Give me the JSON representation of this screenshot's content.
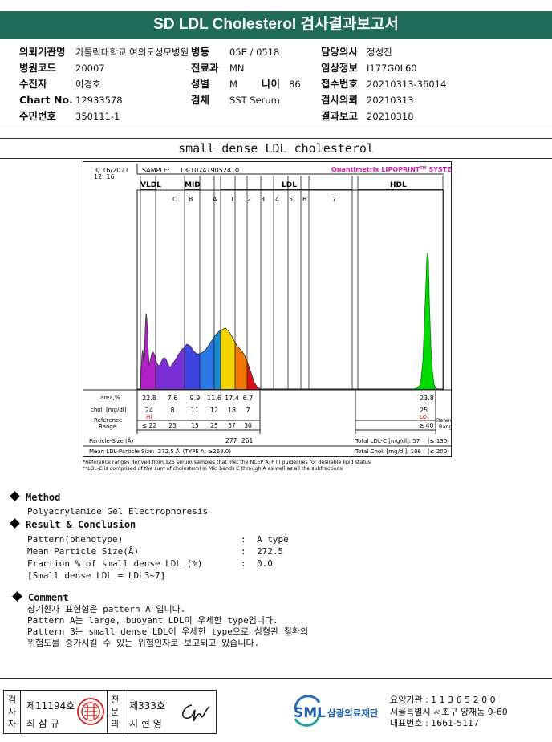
{
  "title": "SD LDL Cholesterol 검사결과보고서",
  "header": {
    "left": [
      {
        "label": "의뢰기관명",
        "value": "가톨릭대학교 여의도성모병원"
      },
      {
        "label": "병원코드",
        "value": "20007"
      },
      {
        "label": "수진자",
        "value": "이경호"
      },
      {
        "label": "Chart No.",
        "value": "12933578"
      },
      {
        "label": "주민번호",
        "value": "350111-1"
      }
    ],
    "mid": [
      {
        "label": "병동",
        "value": "05E / 0518"
      },
      {
        "label": "진료과",
        "value": "MN"
      },
      {
        "label": "성별",
        "value": "M"
      },
      {
        "label": "검체",
        "value": "SST Serum"
      }
    ],
    "age_label": "나이",
    "age_value": "86",
    "right": [
      {
        "label": "담당의사",
        "value": "정성진"
      },
      {
        "label": "임상정보",
        "value": "I177G0L60"
      },
      {
        "label": "접수번호",
        "value": "20210313-36014"
      },
      {
        "label": "검사의뢰",
        "value": "20210313"
      },
      {
        "label": "결과보고",
        "value": "20210318"
      }
    ]
  },
  "section_title": "small dense LDL cholesterol",
  "chart_data": {
    "type": "area",
    "date": "3/ 16/2021",
    "time": "12: 16",
    "sample_label": "SAMPLE:",
    "sample_id": "13-107419052410",
    "system": "Quantimetrix LIPOPRINT",
    "system_sup": "TM",
    "system_tail": " SYSTEM",
    "regions": [
      "VLDL",
      "MID",
      "LDL",
      "HDL"
    ],
    "bands": [
      "C",
      "B",
      "A",
      "1",
      "2",
      "3",
      "4",
      "5",
      "6",
      "7"
    ],
    "row_labels": {
      "area": "area,%",
      "chol": "chol. [mg/dl]",
      "ref1": "Reference",
      "ref2": "Range",
      "particle": "Particle-Size (Å)",
      "mean": "Mean LDL-Particle Size:",
      "mean_value": "272.5 Å",
      "mean_type": "(TYPE A; ≥268.0)"
    },
    "area_values": [
      "22.8",
      "7.6",
      "9.9",
      "11.6",
      "17.4",
      "6.7"
    ],
    "hdl_area": "23.8",
    "chol_values": [
      "24",
      "8",
      "11",
      "12",
      "18",
      "7"
    ],
    "vldl_flag": "HI",
    "hdl_chol": "25",
    "hdl_flag": "LO",
    "ref_values": [
      "≤ 22",
      "23",
      "15",
      "25",
      "57",
      "30"
    ],
    "hdl_ref": "≥ 40",
    "ref_side1": "Reference",
    "ref_side2": "Range",
    "particle_sizes": [
      "277",
      "261"
    ],
    "total_ldl_label": "Total LDL-C [mg/dl]: 57",
    "total_ldl_range": "(≤ 130)",
    "total_chol_label": "Total Chol. [mg/dl]: 106",
    "total_chol_range": "(≤ 200)",
    "footnote1": "*Reference ranges derived from 125 serum samples that met the NCEP ATP III guidelines for desirable lipid status",
    "footnote2": "**LDL-C is comprised of the sum of cholesterol in Mid bands C through A as well as all the subfractions",
    "colors": {
      "vldl": "#b21fc9",
      "mid": "#3357e0",
      "ldl1": "#f1d400",
      "ldl2": "#f07800",
      "ldl3": "#e01010",
      "hdl": "#00dc00"
    }
  },
  "method": {
    "heading": "Method",
    "text": "Polyacrylamide Gel Electrophoresis"
  },
  "result": {
    "heading": "Result & Conclusion",
    "rows": [
      {
        "label": "Pattern(phenotype)",
        "value": "A type"
      },
      {
        "label": "Mean Particle Size(Å)",
        "value": "272.5"
      },
      {
        "label": "Fraction % of small dense LDL (%)",
        "value": "0.0"
      }
    ],
    "note": "[Small dense LDL = LDL3~7]"
  },
  "comment": {
    "heading": "Comment",
    "lines": [
      "상기환자 표현형은 pattern A 입니다.",
      "Pattern A는 large, buoyant LDL이 우세한 type입니다.",
      "Pattern B는 small dense LDL이 우세한 type으로 심혈관 질환의",
      "위험도를 증가시킬 수 있는 위험인자로 보고되고 있습니다."
    ]
  },
  "footer": {
    "tester_label": "검사자",
    "tester_no": "제11194호",
    "tester_name": "최 삼 규",
    "specialist_label": "전문의",
    "specialist_no": "제333호",
    "specialist_name": "지 현 영",
    "logo_text": "SML",
    "org_name": "삼광의료재단",
    "code_line": "요양기관 : 1 1 3 6 5 2 0 0",
    "address": "서울특별시 서초구 양재동 9-60",
    "phone": "대표번호 : 1661-5117"
  }
}
